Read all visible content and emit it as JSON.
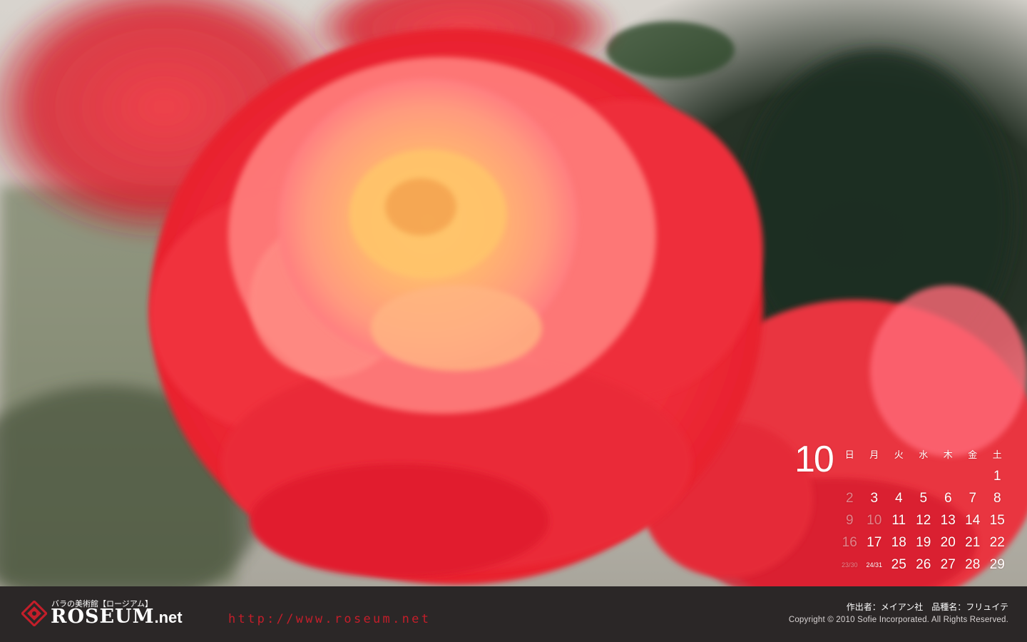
{
  "colors": {
    "footer_background": "#2b2727",
    "url_red": "#c41e2a",
    "rose_red": "#ee2f3a",
    "rose_center": "#ffb070"
  },
  "calendar": {
    "month": "10",
    "weekdays": [
      "日",
      "月",
      "火",
      "水",
      "木",
      "金",
      "土"
    ],
    "rows": [
      [
        "",
        "",
        "",
        "",
        "",
        "",
        "1"
      ],
      [
        "2",
        "3",
        "4",
        "5",
        "6",
        "7",
        "8"
      ],
      [
        "9",
        "10",
        "11",
        "12",
        "13",
        "14",
        "15"
      ],
      [
        "16",
        "17",
        "18",
        "19",
        "20",
        "21",
        "22"
      ],
      [
        "23/30",
        "24/31",
        "25",
        "26",
        "27",
        "28",
        "29"
      ]
    ]
  },
  "footer": {
    "logo_sub": "バラの美術館【ロージアム】",
    "logo_main": "ROSEUM",
    "logo_suffix": ".net",
    "url": "http://www.roseum.net",
    "credit": "作出者：メイアン社　品種名：フリュイテ",
    "copyright": "Copyright © 2010 Sofie Incorporated. All Rights Reserved."
  },
  "photo": {
    "subject_icon": "rose-photo"
  }
}
